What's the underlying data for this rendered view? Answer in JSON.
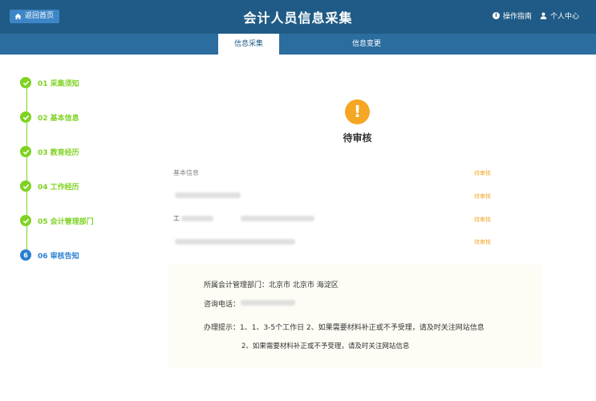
{
  "header": {
    "back_label": "返回首页",
    "title": "会计人员信息采集",
    "guide_label": "操作指南",
    "user_label": "个人中心"
  },
  "tabs": [
    {
      "label": "信息采集",
      "active": true
    },
    {
      "label": "信息变更",
      "active": false
    }
  ],
  "steps": [
    {
      "label": "01 采集须知",
      "done": true
    },
    {
      "label": "02 基本信息",
      "done": true
    },
    {
      "label": "03 教育经历",
      "done": true
    },
    {
      "label": "04 工作经历",
      "done": true
    },
    {
      "label": "05 会计管理部门",
      "done": true
    },
    {
      "label": "06 审核告知",
      "done": false,
      "number": "6"
    }
  ],
  "status": {
    "icon_glyph": "!",
    "text": "待审核"
  },
  "rows": [
    {
      "label": "基本信息",
      "status": "待审核"
    },
    {
      "label": "",
      "status": "待审核"
    },
    {
      "label": "工",
      "status": "待审核"
    },
    {
      "label": "",
      "status": "待审核"
    }
  ],
  "panel": {
    "dept": "所属会计管理部门：北京市 北京市 海淀区",
    "phone_label": "咨询电话：",
    "tip_line1": "办理提示：1、1、3-5个工作日 2、如果需要材料补正或不予受理，请及时关注网站信息",
    "tip_line2": "2、如果需要材料补正或不予受理，请及时关注网站信息"
  },
  "colors": {
    "header_bg": "#1f5b86",
    "tab_bg": "#2b6d9f",
    "step_done": "#7ed321",
    "step_current": "#2a7fd0",
    "pending": "#f5a623"
  }
}
